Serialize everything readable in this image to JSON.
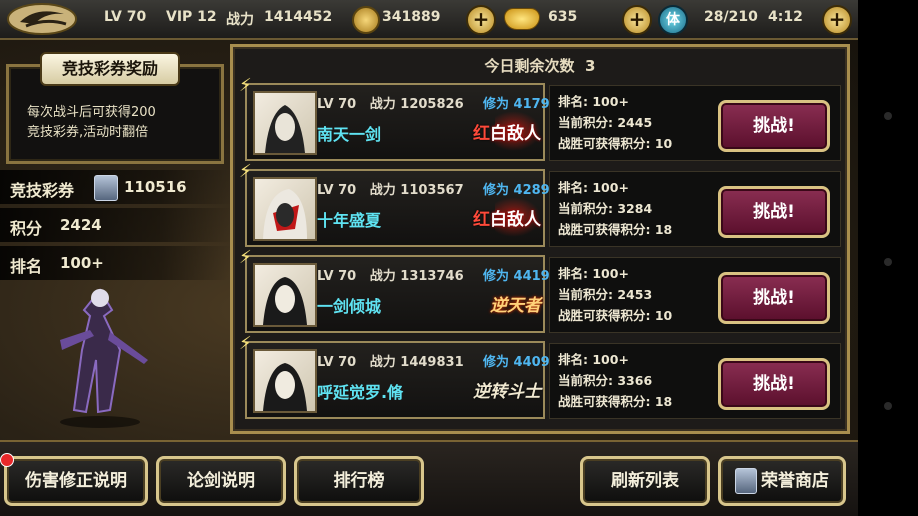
{
  "topbar": {
    "level": "LV 70",
    "vip": "VIP 12",
    "power_label": "战力",
    "power_value": "1414452",
    "coins": "341889",
    "gold": "635",
    "stamina_icon": "体",
    "stamina": "28/210",
    "timer": "4:12"
  },
  "reward": {
    "title": "竞技彩券奖励",
    "desc_line1": "每次战斗后可获得200",
    "desc_line2": "竞技彩券,活动时翻倍"
  },
  "stats": {
    "ticket_label": "竞技彩券",
    "ticket_value": "110516",
    "score_label": "积分",
    "score_value": "2424",
    "rank_label": "排名",
    "rank_value": "100+"
  },
  "panel": {
    "remaining_label": "今日剩余次数",
    "remaining_value": "3"
  },
  "opponents": [
    {
      "lv": "LV 70",
      "power_label": "战力",
      "power": "1205826",
      "xiu": "修为 4179",
      "name": "南天一剑",
      "title": "白敌人",
      "title_prefix": "红",
      "rank": "排名: 100+",
      "score": "当前积分: 2445",
      "win": "战胜可获得积分: 10",
      "button": "挑战!"
    },
    {
      "lv": "LV 70",
      "power_label": "战力",
      "power": "1103567",
      "xiu": "修为 4289",
      "name": "十年盛夏",
      "title": "白敌人",
      "title_prefix": "红",
      "rank": "排名: 100+",
      "score": "当前积分: 3284",
      "win": "战胜可获得积分: 18",
      "button": "挑战!"
    },
    {
      "lv": "LV 70",
      "power_label": "战力",
      "power": "1313746",
      "xiu": "修为 4419",
      "name": "一剑倾城",
      "title": "逆天者",
      "title_prefix": "",
      "rank": "排名: 100+",
      "score": "当前积分: 2453",
      "win": "战胜可获得积分: 10",
      "button": "挑战!"
    },
    {
      "lv": "LV 70",
      "power_label": "战力",
      "power": "1449831",
      "xiu": "修为 4409",
      "name": "呼延觉罗.脩",
      "title": "逆转斗士",
      "title_prefix": "",
      "rank": "排名: 100+",
      "score": "当前积分: 3366",
      "win": "战胜可获得积分: 18",
      "button": "挑战!"
    }
  ],
  "bottom": {
    "damage": "伤害修正说明",
    "lunjian": "论剑说明",
    "leaderboard": "排行榜",
    "refresh": "刷新列表",
    "shop": "荣誉商店"
  },
  "colors": {
    "accent_gold": "#a88e4e",
    "name_cyan": "#5fe3f2",
    "xiu_blue": "#4fb6f0",
    "challenge_button": "#8a2e52"
  }
}
